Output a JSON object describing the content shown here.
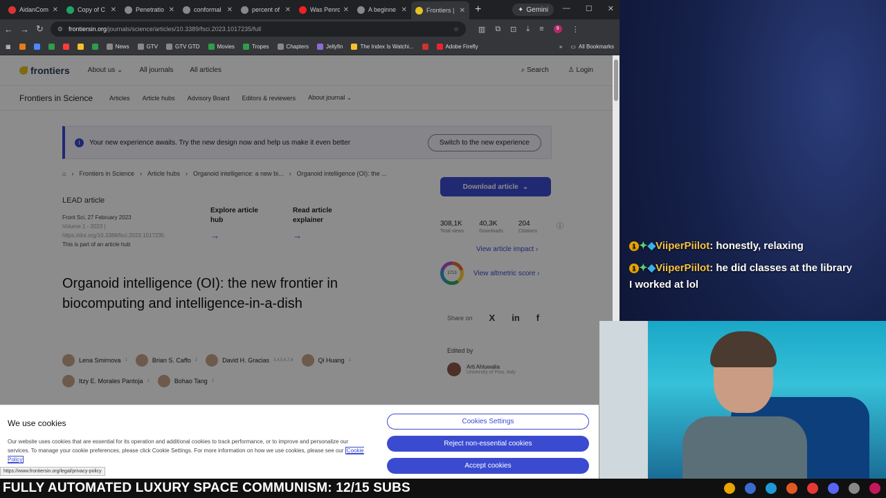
{
  "browser": {
    "tabs": [
      {
        "title": "AidanCom",
        "color": "#d33"
      },
      {
        "title": "Copy of C",
        "color": "#1ea362"
      },
      {
        "title": "Penetratio",
        "color": "#888"
      },
      {
        "title": "conformal",
        "color": "#888"
      },
      {
        "title": "percent of",
        "color": "#888"
      },
      {
        "title": "Was Penro",
        "color": "#e22"
      },
      {
        "title": "A beginne",
        "color": "#888"
      },
      {
        "title": "Frontiers |",
        "color": "#e5c320"
      }
    ],
    "new_tab": "+",
    "gemini_label": "Gemini",
    "url_host": "frontiersin.org",
    "url_path": "/journals/science/articles/10.3389/fsci.2023.1017235/full",
    "profile_initial": "9",
    "bookmarks": [
      {
        "label": "",
        "color": "#e87b20"
      },
      {
        "label": "",
        "color": "#4a88ff"
      },
      {
        "label": "",
        "color": "#2e9d4c"
      },
      {
        "label": "",
        "color": "#ff3d3d"
      },
      {
        "label": "",
        "color": "#f7c02a"
      },
      {
        "label": "",
        "color": "#2e9d4c"
      },
      {
        "label": "News",
        "color": "#888"
      },
      {
        "label": "GTV",
        "color": "#888"
      },
      {
        "label": "GTV GTD",
        "color": "#888"
      },
      {
        "label": "Movies",
        "color": "#2e9d4c"
      },
      {
        "label": "Tropes",
        "color": "#2e9d4c"
      },
      {
        "label": "Chapters",
        "color": "#888"
      },
      {
        "label": "Jellyfin",
        "color": "#8d6bd9"
      },
      {
        "label": "The Index Is Watchi...",
        "color": "#f7c02a"
      },
      {
        "label": "",
        "color": "#c33"
      },
      {
        "label": "Adobe Firefly",
        "color": "#e23"
      }
    ],
    "all_bookmarks": "All Bookmarks",
    "status_url": "https://www.frontiersin.org/legal/privacy-policy"
  },
  "site": {
    "logo": "frontiers",
    "nav_main": [
      "About us",
      "All journals",
      "All articles"
    ],
    "search": "Search",
    "login": "Login",
    "journal": "Frontiers in Science",
    "nav_journal": [
      "Articles",
      "Article hubs",
      "Advisory Board",
      "Editors & reviewers",
      "About journal"
    ],
    "banner_text": "Your new experience awaits. Try the new design now and help us make it even better",
    "banner_button": "Switch to the new experience",
    "breadcrumbs": [
      "Frontiers in Science",
      "Article hubs",
      "Organoid intelligence: a new bi...",
      "Organoid intelligence (OI): the ..."
    ],
    "lead_label": "LEAD article",
    "meta_date": "Front Sci, 27 February 2023",
    "meta_volume": "Volume 1 - 2023 |",
    "meta_doi": "https://doi.org/10.3389/fsci.2023.1017235",
    "meta_hub": "This is part of an article hub",
    "hub_explore": "Explore article hub",
    "hub_read": "Read article explainer",
    "title": "Organoid intelligence (OI): the new frontier in biocomputing and intelligence-in-a-dish",
    "authors": [
      {
        "name": "Lena Smirnova",
        "sup": "1"
      },
      {
        "name": "Brian S. Caffo",
        "sup": "2"
      },
      {
        "name": "David H. Gracias",
        "sup": "3,4,5,6,7,8"
      },
      {
        "name": "Qi Huang",
        "sup": "1"
      },
      {
        "name": "Itzy E. Morales Pantoja",
        "sup": "1"
      },
      {
        "name": "Bohao Tang",
        "sup": "2"
      }
    ],
    "download": "Download article",
    "stats": [
      {
        "value": "308,1K",
        "label": "Total views"
      },
      {
        "value": "40,3K",
        "label": "Downloads"
      },
      {
        "value": "204",
        "label": "Citations"
      }
    ],
    "impact_link": "View article impact",
    "altmetric_score": "1713",
    "altmetric_link": "View altmetric score",
    "share_label": "Share on",
    "share_icons": [
      "X",
      "in",
      "f"
    ],
    "edited_by": "Edited by",
    "editor_name": "Arti Ahluwalia",
    "editor_aff": "University of Pisa, Italy"
  },
  "cookie": {
    "title": "We use cookies",
    "text": "Our website uses cookies that are essential for its operation and additional cookies to track performance, or to improve and personalize our services. To manage your cookie preferences, please click Cookie Settings. For more information on how we use cookies, please see our",
    "policy_link": "Cookie Policy",
    "settings_button": "Cookies Settings",
    "reject_button": "Reject non-essential cookies",
    "accept_button": "Accept cookies"
  },
  "chat": [
    {
      "badge": "1",
      "user": "ViiperPiilot",
      "message": "honestly, relaxing"
    },
    {
      "badge": "1",
      "user": "ViiperPiilot",
      "message": "he did classes at the library I worked at lol"
    }
  ],
  "ticker": {
    "text": "FULLY AUTOMATED LUXURY SPACE COMMUNISM: 12/15 SUBS",
    "tray_icons": [
      "#e8a400",
      "#3b6bd0",
      "#1e9bd7",
      "#e25822",
      "#e53935",
      "#5865f2",
      "#888",
      "#c2185b"
    ]
  }
}
